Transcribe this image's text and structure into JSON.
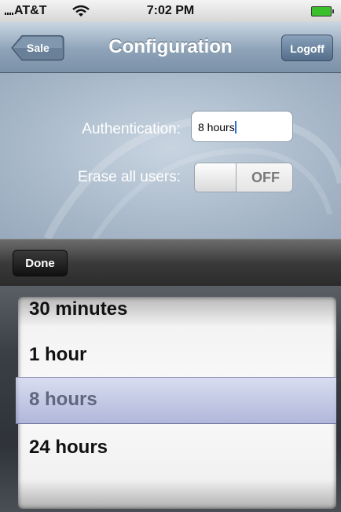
{
  "status_bar": {
    "carrier": "AT&T",
    "time": "7:02 PM"
  },
  "nav": {
    "title": "Configuration",
    "back_label": "Sale",
    "logoff_label": "Logoff"
  },
  "form": {
    "authentication_label": "Authentication:",
    "authentication_value": "8 hours",
    "erase_label": "Erase all users:",
    "erase_switch_state": "OFF"
  },
  "toolbar": {
    "done_label": "Done"
  },
  "picker": {
    "options": [
      "30 minutes",
      "1 hour",
      "8 hours",
      "24 hours"
    ],
    "selected": "8 hours"
  },
  "colors": {
    "nav_accent": "#7b91a8",
    "selection": "#a8b0d6",
    "battery": "#3bbf2a"
  }
}
